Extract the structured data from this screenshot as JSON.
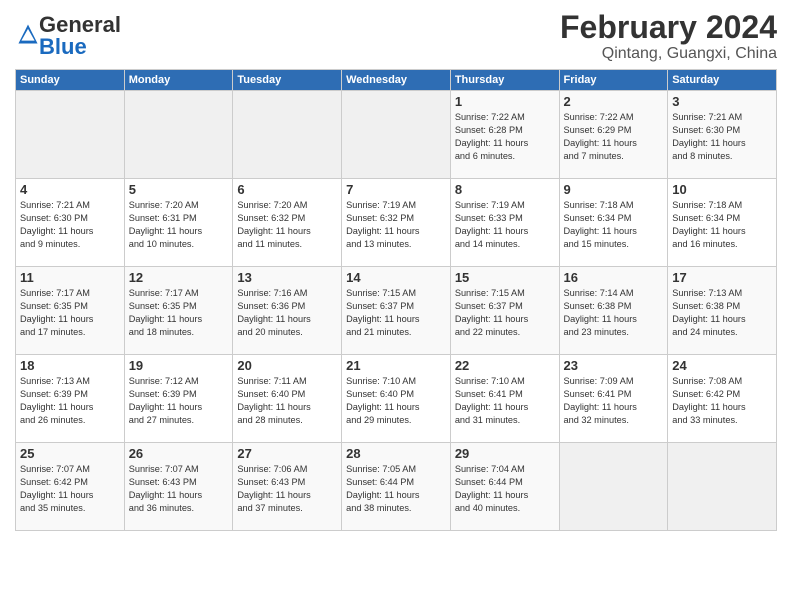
{
  "logo": {
    "general": "General",
    "blue": "Blue"
  },
  "title": "February 2024",
  "subtitle": "Qintang, Guangxi, China",
  "days_header": [
    "Sunday",
    "Monday",
    "Tuesday",
    "Wednesday",
    "Thursday",
    "Friday",
    "Saturday"
  ],
  "weeks": [
    [
      {
        "day": "",
        "info": ""
      },
      {
        "day": "",
        "info": ""
      },
      {
        "day": "",
        "info": ""
      },
      {
        "day": "",
        "info": ""
      },
      {
        "day": "1",
        "info": "Sunrise: 7:22 AM\nSunset: 6:28 PM\nDaylight: 11 hours\nand 6 minutes."
      },
      {
        "day": "2",
        "info": "Sunrise: 7:22 AM\nSunset: 6:29 PM\nDaylight: 11 hours\nand 7 minutes."
      },
      {
        "day": "3",
        "info": "Sunrise: 7:21 AM\nSunset: 6:30 PM\nDaylight: 11 hours\nand 8 minutes."
      }
    ],
    [
      {
        "day": "4",
        "info": "Sunrise: 7:21 AM\nSunset: 6:30 PM\nDaylight: 11 hours\nand 9 minutes."
      },
      {
        "day": "5",
        "info": "Sunrise: 7:20 AM\nSunset: 6:31 PM\nDaylight: 11 hours\nand 10 minutes."
      },
      {
        "day": "6",
        "info": "Sunrise: 7:20 AM\nSunset: 6:32 PM\nDaylight: 11 hours\nand 11 minutes."
      },
      {
        "day": "7",
        "info": "Sunrise: 7:19 AM\nSunset: 6:32 PM\nDaylight: 11 hours\nand 13 minutes."
      },
      {
        "day": "8",
        "info": "Sunrise: 7:19 AM\nSunset: 6:33 PM\nDaylight: 11 hours\nand 14 minutes."
      },
      {
        "day": "9",
        "info": "Sunrise: 7:18 AM\nSunset: 6:34 PM\nDaylight: 11 hours\nand 15 minutes."
      },
      {
        "day": "10",
        "info": "Sunrise: 7:18 AM\nSunset: 6:34 PM\nDaylight: 11 hours\nand 16 minutes."
      }
    ],
    [
      {
        "day": "11",
        "info": "Sunrise: 7:17 AM\nSunset: 6:35 PM\nDaylight: 11 hours\nand 17 minutes."
      },
      {
        "day": "12",
        "info": "Sunrise: 7:17 AM\nSunset: 6:35 PM\nDaylight: 11 hours\nand 18 minutes."
      },
      {
        "day": "13",
        "info": "Sunrise: 7:16 AM\nSunset: 6:36 PM\nDaylight: 11 hours\nand 20 minutes."
      },
      {
        "day": "14",
        "info": "Sunrise: 7:15 AM\nSunset: 6:37 PM\nDaylight: 11 hours\nand 21 minutes."
      },
      {
        "day": "15",
        "info": "Sunrise: 7:15 AM\nSunset: 6:37 PM\nDaylight: 11 hours\nand 22 minutes."
      },
      {
        "day": "16",
        "info": "Sunrise: 7:14 AM\nSunset: 6:38 PM\nDaylight: 11 hours\nand 23 minutes."
      },
      {
        "day": "17",
        "info": "Sunrise: 7:13 AM\nSunset: 6:38 PM\nDaylight: 11 hours\nand 24 minutes."
      }
    ],
    [
      {
        "day": "18",
        "info": "Sunrise: 7:13 AM\nSunset: 6:39 PM\nDaylight: 11 hours\nand 26 minutes."
      },
      {
        "day": "19",
        "info": "Sunrise: 7:12 AM\nSunset: 6:39 PM\nDaylight: 11 hours\nand 27 minutes."
      },
      {
        "day": "20",
        "info": "Sunrise: 7:11 AM\nSunset: 6:40 PM\nDaylight: 11 hours\nand 28 minutes."
      },
      {
        "day": "21",
        "info": "Sunrise: 7:10 AM\nSunset: 6:40 PM\nDaylight: 11 hours\nand 29 minutes."
      },
      {
        "day": "22",
        "info": "Sunrise: 7:10 AM\nSunset: 6:41 PM\nDaylight: 11 hours\nand 31 minutes."
      },
      {
        "day": "23",
        "info": "Sunrise: 7:09 AM\nSunset: 6:41 PM\nDaylight: 11 hours\nand 32 minutes."
      },
      {
        "day": "24",
        "info": "Sunrise: 7:08 AM\nSunset: 6:42 PM\nDaylight: 11 hours\nand 33 minutes."
      }
    ],
    [
      {
        "day": "25",
        "info": "Sunrise: 7:07 AM\nSunset: 6:42 PM\nDaylight: 11 hours\nand 35 minutes."
      },
      {
        "day": "26",
        "info": "Sunrise: 7:07 AM\nSunset: 6:43 PM\nDaylight: 11 hours\nand 36 minutes."
      },
      {
        "day": "27",
        "info": "Sunrise: 7:06 AM\nSunset: 6:43 PM\nDaylight: 11 hours\nand 37 minutes."
      },
      {
        "day": "28",
        "info": "Sunrise: 7:05 AM\nSunset: 6:44 PM\nDaylight: 11 hours\nand 38 minutes."
      },
      {
        "day": "29",
        "info": "Sunrise: 7:04 AM\nSunset: 6:44 PM\nDaylight: 11 hours\nand 40 minutes."
      },
      {
        "day": "",
        "info": ""
      },
      {
        "day": "",
        "info": ""
      }
    ]
  ]
}
